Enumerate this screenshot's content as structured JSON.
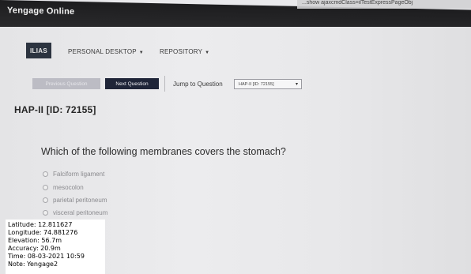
{
  "browser": {
    "title": "Yengage Online",
    "url_fragment": "...show ajaxcmdClass=ilTestExpressPageObj"
  },
  "header": {
    "logo": "ILIAS",
    "nav": [
      {
        "label": "PERSONAL DESKTOP"
      },
      {
        "label": "REPOSITORY"
      }
    ]
  },
  "toolbar": {
    "prev_label": "Previous Question",
    "next_label": "Next Question",
    "jump_label": "Jump to Question",
    "jump_selected": "HAP-II [ID: 72155]"
  },
  "question": {
    "title": "HAP-II [ID: 72155]",
    "text": "Which of the following membranes covers the stomach?",
    "options": [
      "Falciform ligament",
      "mesocolon",
      "parietal peritoneum",
      "visceral peritoneum"
    ]
  },
  "gps": {
    "latitude": "Latitude: 12.811627",
    "longitude": "Longitude: 74.881276",
    "elevation": "Elevation: 56.7m",
    "accuracy": "Accuracy: 20.9m",
    "time": "Time: 08-03-2021 10:59",
    "note": "Note: Yengage2"
  },
  "colors": {
    "title_bar": "#1d1d1f",
    "next_button": "#1f2538",
    "prev_button_disabled": "#bcbcc4"
  }
}
